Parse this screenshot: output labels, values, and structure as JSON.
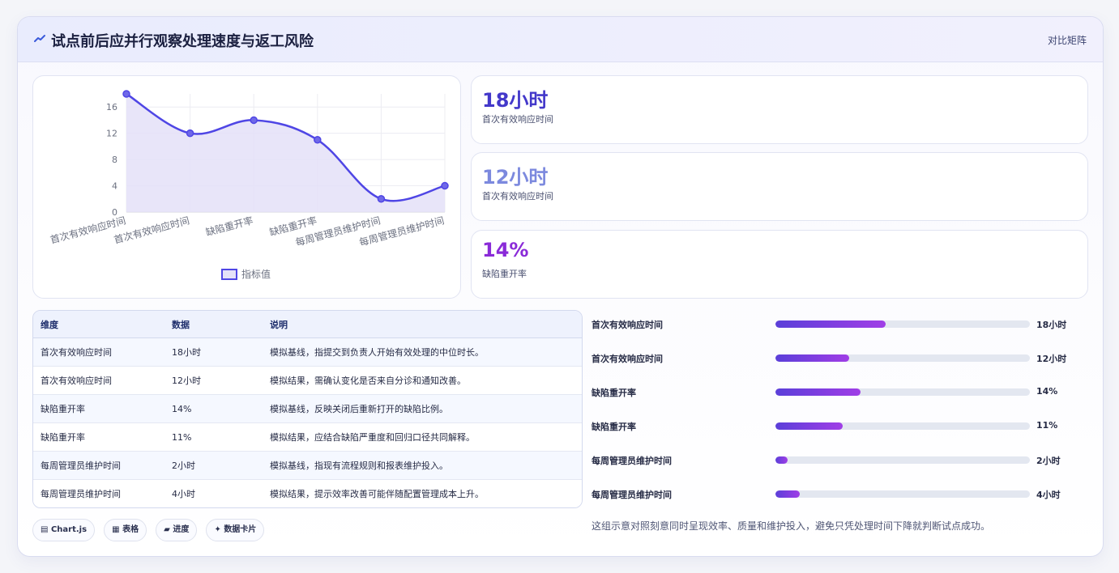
{
  "header": {
    "title": "试点前后应并行观察处理速度与返工风险",
    "link": "对比矩阵",
    "icon": "trend-icon"
  },
  "chart_data": {
    "type": "line",
    "categories": [
      "首次有效响应时间",
      "首次有效响应时间",
      "缺陷重开率",
      "缺陷重开率",
      "每周管理员维护时间",
      "每周管理员维护时间"
    ],
    "series": [
      {
        "name": "指标值",
        "values": [
          18,
          12,
          14,
          11,
          2,
          4
        ]
      }
    ],
    "yticks": [
      0,
      4,
      8,
      12,
      16
    ],
    "ylim": [
      0,
      18
    ],
    "grid": true,
    "fill": true,
    "legend_position": "bottom",
    "colors": {
      "line": "#4f46e5",
      "fill": "#e4e1f8"
    }
  },
  "stats": [
    {
      "value": "18小时",
      "label": "首次有效响应时间",
      "color": "#4338ca"
    },
    {
      "value": "12小时",
      "label": "首次有效响应时间",
      "color": "#7c89de"
    },
    {
      "value": "14%",
      "label": "缺陷重开率",
      "color": "#8a2bd8"
    }
  ],
  "table": {
    "headers": [
      "维度",
      "数据",
      "说明"
    ],
    "rows": [
      [
        "首次有效响应时间",
        "18小时",
        "模拟基线，指提交到负责人开始有效处理的中位时长。"
      ],
      [
        "首次有效响应时间",
        "12小时",
        "模拟结果，需确认变化是否来自分诊和通知改善。"
      ],
      [
        "缺陷重开率",
        "14%",
        "模拟基线，反映关闭后重新打开的缺陷比例。"
      ],
      [
        "缺陷重开率",
        "11%",
        "模拟结果，应结合缺陷严重度和回归口径共同解释。"
      ],
      [
        "每周管理员维护时间",
        "2小时",
        "模拟基线，指现有流程规则和报表维护投入。"
      ],
      [
        "每周管理员维护时间",
        "4小时",
        "模拟结果，提示效率改善可能伴随配置管理成本上升。"
      ]
    ]
  },
  "chips": [
    "Chart.js",
    "表格",
    "进度",
    "数据卡片"
  ],
  "progress": [
    {
      "label": "首次有效响应时间",
      "value": "18小时",
      "fraction": 0.434
    },
    {
      "label": "首次有效响应时间",
      "value": "12小时",
      "fraction": 0.289
    },
    {
      "label": "缺陷重开率",
      "value": "14%",
      "fraction": 0.334
    },
    {
      "label": "缺陷重开率",
      "value": "11%",
      "fraction": 0.265
    },
    {
      "label": "每周管理员维护时间",
      "value": "2小时",
      "fraction": 0.048
    },
    {
      "label": "每周管理员维护时间",
      "value": "4小时",
      "fraction": 0.096
    }
  ],
  "footnote": "这组示意对照刻意同时呈现效率、质量和维护投入，避免只凭处理时间下降就判断试点成功。"
}
